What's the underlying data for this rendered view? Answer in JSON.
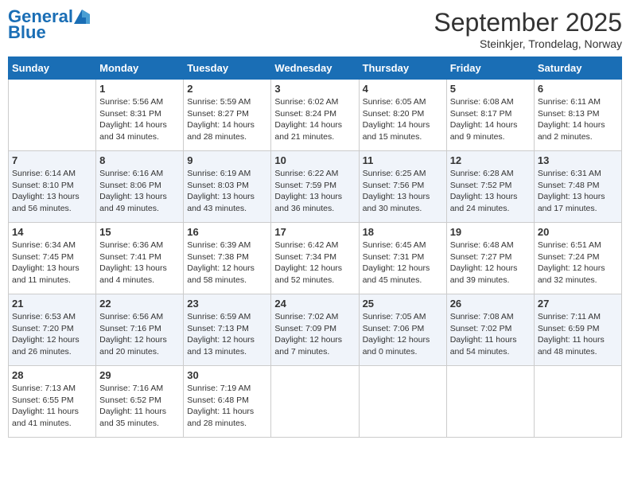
{
  "logo": {
    "text_general": "General",
    "text_blue": "Blue"
  },
  "header": {
    "month": "September 2025",
    "location": "Steinkjer, Trondelag, Norway"
  },
  "days_of_week": [
    "Sunday",
    "Monday",
    "Tuesday",
    "Wednesday",
    "Thursday",
    "Friday",
    "Saturday"
  ],
  "weeks": [
    [
      {
        "day": "",
        "info": ""
      },
      {
        "day": "1",
        "info": "Sunrise: 5:56 AM\nSunset: 8:31 PM\nDaylight: 14 hours\nand 34 minutes."
      },
      {
        "day": "2",
        "info": "Sunrise: 5:59 AM\nSunset: 8:27 PM\nDaylight: 14 hours\nand 28 minutes."
      },
      {
        "day": "3",
        "info": "Sunrise: 6:02 AM\nSunset: 8:24 PM\nDaylight: 14 hours\nand 21 minutes."
      },
      {
        "day": "4",
        "info": "Sunrise: 6:05 AM\nSunset: 8:20 PM\nDaylight: 14 hours\nand 15 minutes."
      },
      {
        "day": "5",
        "info": "Sunrise: 6:08 AM\nSunset: 8:17 PM\nDaylight: 14 hours\nand 9 minutes."
      },
      {
        "day": "6",
        "info": "Sunrise: 6:11 AM\nSunset: 8:13 PM\nDaylight: 14 hours\nand 2 minutes."
      }
    ],
    [
      {
        "day": "7",
        "info": "Sunrise: 6:14 AM\nSunset: 8:10 PM\nDaylight: 13 hours\nand 56 minutes."
      },
      {
        "day": "8",
        "info": "Sunrise: 6:16 AM\nSunset: 8:06 PM\nDaylight: 13 hours\nand 49 minutes."
      },
      {
        "day": "9",
        "info": "Sunrise: 6:19 AM\nSunset: 8:03 PM\nDaylight: 13 hours\nand 43 minutes."
      },
      {
        "day": "10",
        "info": "Sunrise: 6:22 AM\nSunset: 7:59 PM\nDaylight: 13 hours\nand 36 minutes."
      },
      {
        "day": "11",
        "info": "Sunrise: 6:25 AM\nSunset: 7:56 PM\nDaylight: 13 hours\nand 30 minutes."
      },
      {
        "day": "12",
        "info": "Sunrise: 6:28 AM\nSunset: 7:52 PM\nDaylight: 13 hours\nand 24 minutes."
      },
      {
        "day": "13",
        "info": "Sunrise: 6:31 AM\nSunset: 7:48 PM\nDaylight: 13 hours\nand 17 minutes."
      }
    ],
    [
      {
        "day": "14",
        "info": "Sunrise: 6:34 AM\nSunset: 7:45 PM\nDaylight: 13 hours\nand 11 minutes."
      },
      {
        "day": "15",
        "info": "Sunrise: 6:36 AM\nSunset: 7:41 PM\nDaylight: 13 hours\nand 4 minutes."
      },
      {
        "day": "16",
        "info": "Sunrise: 6:39 AM\nSunset: 7:38 PM\nDaylight: 12 hours\nand 58 minutes."
      },
      {
        "day": "17",
        "info": "Sunrise: 6:42 AM\nSunset: 7:34 PM\nDaylight: 12 hours\nand 52 minutes."
      },
      {
        "day": "18",
        "info": "Sunrise: 6:45 AM\nSunset: 7:31 PM\nDaylight: 12 hours\nand 45 minutes."
      },
      {
        "day": "19",
        "info": "Sunrise: 6:48 AM\nSunset: 7:27 PM\nDaylight: 12 hours\nand 39 minutes."
      },
      {
        "day": "20",
        "info": "Sunrise: 6:51 AM\nSunset: 7:24 PM\nDaylight: 12 hours\nand 32 minutes."
      }
    ],
    [
      {
        "day": "21",
        "info": "Sunrise: 6:53 AM\nSunset: 7:20 PM\nDaylight: 12 hours\nand 26 minutes."
      },
      {
        "day": "22",
        "info": "Sunrise: 6:56 AM\nSunset: 7:16 PM\nDaylight: 12 hours\nand 20 minutes."
      },
      {
        "day": "23",
        "info": "Sunrise: 6:59 AM\nSunset: 7:13 PM\nDaylight: 12 hours\nand 13 minutes."
      },
      {
        "day": "24",
        "info": "Sunrise: 7:02 AM\nSunset: 7:09 PM\nDaylight: 12 hours\nand 7 minutes."
      },
      {
        "day": "25",
        "info": "Sunrise: 7:05 AM\nSunset: 7:06 PM\nDaylight: 12 hours\nand 0 minutes."
      },
      {
        "day": "26",
        "info": "Sunrise: 7:08 AM\nSunset: 7:02 PM\nDaylight: 11 hours\nand 54 minutes."
      },
      {
        "day": "27",
        "info": "Sunrise: 7:11 AM\nSunset: 6:59 PM\nDaylight: 11 hours\nand 48 minutes."
      }
    ],
    [
      {
        "day": "28",
        "info": "Sunrise: 7:13 AM\nSunset: 6:55 PM\nDaylight: 11 hours\nand 41 minutes."
      },
      {
        "day": "29",
        "info": "Sunrise: 7:16 AM\nSunset: 6:52 PM\nDaylight: 11 hours\nand 35 minutes."
      },
      {
        "day": "30",
        "info": "Sunrise: 7:19 AM\nSunset: 6:48 PM\nDaylight: 11 hours\nand 28 minutes."
      },
      {
        "day": "",
        "info": ""
      },
      {
        "day": "",
        "info": ""
      },
      {
        "day": "",
        "info": ""
      },
      {
        "day": "",
        "info": ""
      }
    ]
  ]
}
